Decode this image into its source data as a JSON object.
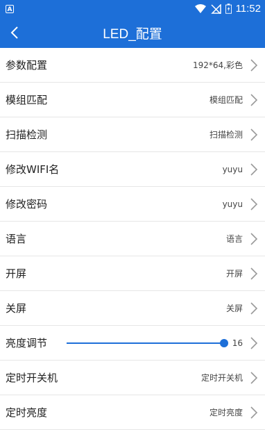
{
  "status_bar": {
    "app_badge": "A",
    "time": "11:52",
    "icons": [
      "wifi-icon",
      "no-signal-icon",
      "battery-charging-icon"
    ]
  },
  "app_bar": {
    "title": "LED_配置",
    "back_icon": "chevron-left-icon"
  },
  "settings": [
    {
      "label": "参数配置",
      "value": "192*64,彩色"
    },
    {
      "label": "模组匹配",
      "value": "模组匹配"
    },
    {
      "label": "扫描检测",
      "value": "扫描检测"
    },
    {
      "label": "修改WIFI名",
      "value": "yuyu"
    },
    {
      "label": "修改密码",
      "value": "yuyu"
    },
    {
      "label": "语言",
      "value": "语言"
    },
    {
      "label": "开屏",
      "value": "开屏"
    },
    {
      "label": "关屏",
      "value": "关屏"
    },
    {
      "label": "亮度调节",
      "value": "16",
      "slider_fraction": 1.0
    },
    {
      "label": "定时开关机",
      "value": "定时开关机"
    },
    {
      "label": "定时亮度",
      "value": "定时亮度"
    }
  ],
  "colors": {
    "primary": "#1d6fd8",
    "background": "#f2f2f2",
    "row": "#ffffff",
    "chevron": "#999999"
  }
}
